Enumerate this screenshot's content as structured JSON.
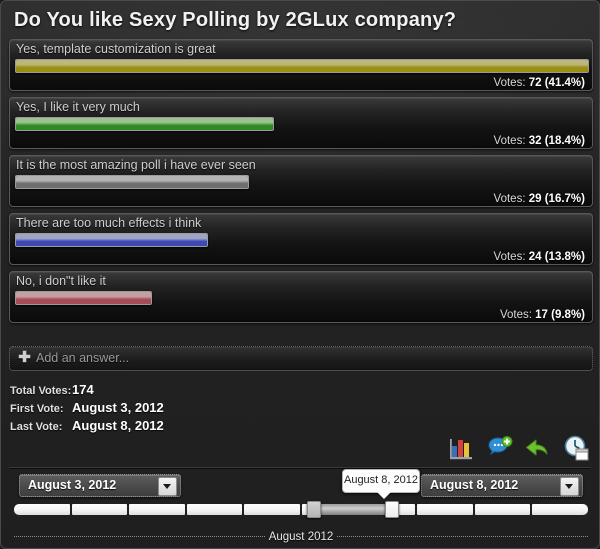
{
  "poll": {
    "title": "Do You like Sexy Polling by 2GLux company?",
    "answers": [
      {
        "label": "Yes, template customization is great",
        "votes_prefix": "Votes:",
        "votes": "72",
        "percent": "(41.4%)",
        "bar_percent": 100,
        "color_top": "#bdb77e",
        "color_bottom": "#9a8f12"
      },
      {
        "label": "Yes, I like it very much",
        "votes_prefix": "Votes:",
        "votes": "32",
        "percent": "(18.4%)",
        "bar_percent": 45.1,
        "color_top": "#9cc28e",
        "color_bottom": "#2f8a26"
      },
      {
        "label": "It is the most amazing poll i have ever seen",
        "votes_prefix": "Votes:",
        "votes": "29",
        "percent": "(16.7%)",
        "bar_percent": 40.8,
        "color_top": "#b4b4b4",
        "color_bottom": "#6e6e6e"
      },
      {
        "label": "There are too much effects i think",
        "votes_prefix": "Votes:",
        "votes": "24",
        "percent": "(13.8%)",
        "bar_percent": 33.6,
        "color_top": "#9ea4c2",
        "color_bottom": "#3c48b4"
      },
      {
        "label": "No, i don\"t like it",
        "votes_prefix": "Votes:",
        "votes": "17",
        "percent": "(9.8%)",
        "bar_percent": 23.9,
        "color_top": "#c4a0a3",
        "color_bottom": "#a64c56"
      }
    ],
    "add_answer_placeholder": "Add an answer...",
    "add_answer_icon": "plus-icon",
    "stats": [
      {
        "key": "Total Votes:",
        "value": "174"
      },
      {
        "key": "First Vote:",
        "value": "August 3, 2012"
      },
      {
        "key": "Last Vote:",
        "value": "August 8, 2012"
      }
    ]
  },
  "toolbar": {
    "items": [
      {
        "icon": "bar-chart-icon",
        "label": "Statistics"
      },
      {
        "icon": "add-comment-icon",
        "label": "Add comment"
      },
      {
        "icon": "undo-arrow-icon",
        "label": "Reset"
      },
      {
        "icon": "clock-calendar-icon",
        "label": "Date range"
      }
    ]
  },
  "date_range": {
    "start_label": "August 3, 2012",
    "end_label": "August 8, 2012",
    "tooltip": "August 8, 2012",
    "axis_label": "August 2012",
    "slider": {
      "segments": 10,
      "left_handle_pct": 52.3,
      "right_handle_pct": 166.0,
      "left_pos_pct": 52.3,
      "right_pos_pct": 65.9
    }
  },
  "colors": {
    "background": "#262626",
    "border": "#4a4a4a",
    "text": "#cfcfcf",
    "title": "#f2f2f2"
  }
}
